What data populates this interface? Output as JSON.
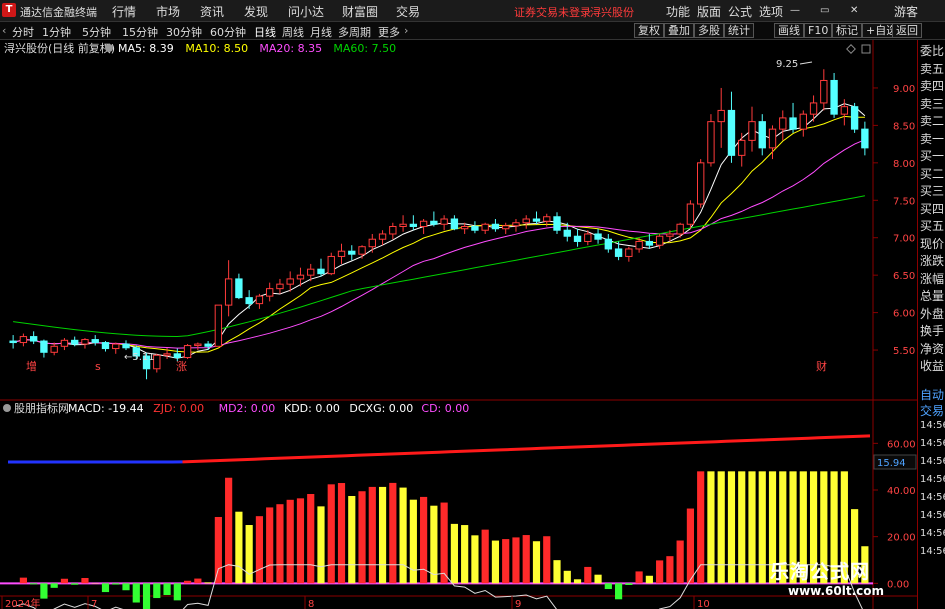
{
  "menubar": {
    "app_title": "通达信金融终端",
    "items": [
      "行情",
      "市场",
      "资讯",
      "发现",
      "问小达",
      "财富圈",
      "交易"
    ],
    "notice": "证券交易未登录",
    "stock": "浔兴股份",
    "right_items": [
      "功能",
      "版面",
      "公式",
      "选项"
    ],
    "guest": "游客"
  },
  "toolbar": {
    "periods": [
      "分时",
      "1分钟",
      "5分钟",
      "15分钟",
      "30分钟",
      "60分钟",
      "日线",
      "周线",
      "月线",
      "多周期",
      "更多"
    ],
    "active": "日线",
    "buttons": [
      "复权",
      "叠加",
      "多股",
      "统计",
      "画线",
      "F10",
      "标记",
      "+自选",
      "返回"
    ]
  },
  "main_header": {
    "title": "浔兴股份(日线 前复权)",
    "ma": [
      {
        "label": "MA5: 8.39",
        "color": "#ffffff"
      },
      {
        "label": "MA10: 8.50",
        "color": "#ffff00"
      },
      {
        "label": "MA20: 8.35",
        "color": "#ff4dff"
      },
      {
        "label": "MA60: 7.50",
        "color": "#00d200"
      }
    ]
  },
  "price_axis": [
    "9.00",
    "8.50",
    "8.00",
    "7.50",
    "7.00",
    "6.50",
    "6.00",
    "5.50"
  ],
  "annotations": {
    "high": "9.25",
    "low": "5.11",
    "marker_zeng": "增",
    "marker_s": "s",
    "marker_zhang": "涨",
    "marker_cai": "财"
  },
  "indicator_header": {
    "name": "股朋指标网",
    "items": [
      {
        "label": "MACD: -19.44",
        "color": "#ffffff"
      },
      {
        "label": "ZJD: 0.00",
        "color": "#ff3333"
      },
      {
        "label": "MD2: 0.00",
        "color": "#ff4dff"
      },
      {
        "label": "KDD: 0.00",
        "color": "#ffffff"
      },
      {
        "label": "DCXG: 0.00",
        "color": "#ffffff"
      },
      {
        "label": "CD: 0.00",
        "color": "#ff4dff"
      }
    ]
  },
  "indicator_axis": [
    "60.00",
    "40.00",
    "20.00",
    "0.00"
  ],
  "indicator_value": "15.94",
  "date_axis": [
    "2024年",
    "7",
    "8",
    "9",
    "10"
  ],
  "right_panel": {
    "top": [
      "委比",
      "卖五",
      "卖四",
      "卖三",
      "卖二",
      "卖一",
      "买一",
      "买二",
      "买三",
      "买四",
      "买五",
      "现价",
      "涨跌",
      "涨幅",
      "总量",
      "外盘",
      "换手",
      "净资",
      "收益"
    ],
    "auto": "自动",
    "trade": "交易",
    "times": [
      "14:56",
      "14:56",
      "14:56",
      "14:56",
      "14:56",
      "14:56",
      "14:56",
      "14:56"
    ]
  },
  "watermark": {
    "line1": "乐淘公式网",
    "line2": "www.60lt.com"
  },
  "chart_data": {
    "type": "candlestick",
    "dates_note": "2024 Jul–Oct daily",
    "candles": [
      [
        5.62,
        5.7,
        5.52,
        5.6
      ],
      [
        5.6,
        5.72,
        5.55,
        5.68
      ],
      [
        5.68,
        5.75,
        5.58,
        5.62
      ],
      [
        5.62,
        5.64,
        5.4,
        5.47
      ],
      [
        5.47,
        5.6,
        5.43,
        5.55
      ],
      [
        5.55,
        5.66,
        5.5,
        5.63
      ],
      [
        5.63,
        5.68,
        5.55,
        5.58
      ],
      [
        5.58,
        5.66,
        5.52,
        5.64
      ],
      [
        5.64,
        5.7,
        5.56,
        5.6
      ],
      [
        5.6,
        5.62,
        5.48,
        5.52
      ],
      [
        5.52,
        5.6,
        5.45,
        5.58
      ],
      [
        5.58,
        5.63,
        5.5,
        5.53
      ],
      [
        5.53,
        5.56,
        5.38,
        5.42
      ],
      [
        5.42,
        5.46,
        5.11,
        5.25
      ],
      [
        5.25,
        5.45,
        5.2,
        5.43
      ],
      [
        5.43,
        5.53,
        5.38,
        5.45
      ],
      [
        5.45,
        5.52,
        5.35,
        5.4
      ],
      [
        5.4,
        5.58,
        5.38,
        5.56
      ],
      [
        5.56,
        5.6,
        5.5,
        5.58
      ],
      [
        5.58,
        5.62,
        5.5,
        5.55
      ],
      [
        5.55,
        6.1,
        5.55,
        6.1
      ],
      [
        6.1,
        6.7,
        5.95,
        6.45
      ],
      [
        6.45,
        6.52,
        6.18,
        6.2
      ],
      [
        6.2,
        6.3,
        6.05,
        6.12
      ],
      [
        6.12,
        6.25,
        6.05,
        6.22
      ],
      [
        6.22,
        6.4,
        6.15,
        6.32
      ],
      [
        6.32,
        6.45,
        6.25,
        6.38
      ],
      [
        6.38,
        6.55,
        6.28,
        6.45
      ],
      [
        6.45,
        6.6,
        6.35,
        6.5
      ],
      [
        6.5,
        6.65,
        6.42,
        6.58
      ],
      [
        6.58,
        6.72,
        6.48,
        6.52
      ],
      [
        6.52,
        6.8,
        6.5,
        6.75
      ],
      [
        6.75,
        6.92,
        6.65,
        6.82
      ],
      [
        6.82,
        6.9,
        6.7,
        6.78
      ],
      [
        6.78,
        6.9,
        6.72,
        6.88
      ],
      [
        6.88,
        7.05,
        6.8,
        6.98
      ],
      [
        6.98,
        7.1,
        6.9,
        7.05
      ],
      [
        7.05,
        7.2,
        6.98,
        7.15
      ],
      [
        7.15,
        7.3,
        7.08,
        7.18
      ],
      [
        7.18,
        7.3,
        7.1,
        7.15
      ],
      [
        7.15,
        7.25,
        7.05,
        7.22
      ],
      [
        7.22,
        7.35,
        7.15,
        7.18
      ],
      [
        7.18,
        7.3,
        7.1,
        7.25
      ],
      [
        7.25,
        7.3,
        7.1,
        7.12
      ],
      [
        7.12,
        7.2,
        7.05,
        7.15
      ],
      [
        7.15,
        7.22,
        7.06,
        7.1
      ],
      [
        7.1,
        7.2,
        7.05,
        7.18
      ],
      [
        7.18,
        7.25,
        7.08,
        7.12
      ],
      [
        7.12,
        7.2,
        7.05,
        7.16
      ],
      [
        7.16,
        7.25,
        7.08,
        7.2
      ],
      [
        7.2,
        7.3,
        7.12,
        7.25
      ],
      [
        7.25,
        7.35,
        7.18,
        7.22
      ],
      [
        7.22,
        7.32,
        7.15,
        7.28
      ],
      [
        7.28,
        7.34,
        7.05,
        7.1
      ],
      [
        7.1,
        7.2,
        6.95,
        7.02
      ],
      [
        7.02,
        7.12,
        6.88,
        6.95
      ],
      [
        6.95,
        7.1,
        6.9,
        7.05
      ],
      [
        7.05,
        7.12,
        6.92,
        6.98
      ],
      [
        6.98,
        7.05,
        6.8,
        6.85
      ],
      [
        6.85,
        6.95,
        6.7,
        6.75
      ],
      [
        6.75,
        6.88,
        6.68,
        6.85
      ],
      [
        6.85,
        7.0,
        6.8,
        6.95
      ],
      [
        6.95,
        7.05,
        6.85,
        6.9
      ],
      [
        6.9,
        7.05,
        6.85,
        7.02
      ],
      [
        7.02,
        7.1,
        6.95,
        7.05
      ],
      [
        7.05,
        7.2,
        7.0,
        7.18
      ],
      [
        7.18,
        7.5,
        7.12,
        7.45
      ],
      [
        7.45,
        8.05,
        7.4,
        8.0
      ],
      [
        8.0,
        8.65,
        7.95,
        8.55
      ],
      [
        8.55,
        9.0,
        8.2,
        8.7
      ],
      [
        8.7,
        8.95,
        8.0,
        8.1
      ],
      [
        8.1,
        8.4,
        7.95,
        8.3
      ],
      [
        8.3,
        8.75,
        8.15,
        8.55
      ],
      [
        8.55,
        8.65,
        8.1,
        8.2
      ],
      [
        8.2,
        8.5,
        8.05,
        8.45
      ],
      [
        8.45,
        8.7,
        8.3,
        8.6
      ],
      [
        8.6,
        8.8,
        8.4,
        8.45
      ],
      [
        8.45,
        8.7,
        8.35,
        8.65
      ],
      [
        8.65,
        8.9,
        8.55,
        8.8
      ],
      [
        8.8,
        9.25,
        8.7,
        9.1
      ],
      [
        9.1,
        9.2,
        8.6,
        8.65
      ],
      [
        8.65,
        8.85,
        8.5,
        8.75
      ],
      [
        8.75,
        8.8,
        8.4,
        8.45
      ],
      [
        8.45,
        8.55,
        8.1,
        8.2
      ]
    ],
    "ylim": [
      5.1,
      9.4
    ],
    "indicator_bars": {
      "ylim": [
        -2,
        70
      ]
    }
  }
}
